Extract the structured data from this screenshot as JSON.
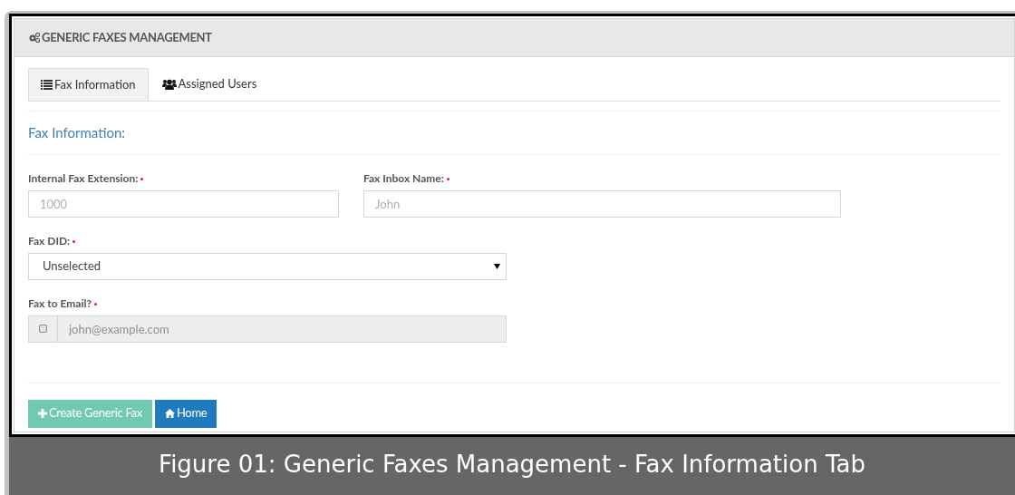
{
  "panel": {
    "title": "GENERIC FAXES MANAGEMENT"
  },
  "tabs": [
    {
      "label": "Fax Information",
      "selected": true
    },
    {
      "label": "Assigned Users",
      "selected": false
    }
  ],
  "section_title": "Fax Information:",
  "fields": [
    {
      "kind": "text",
      "label": "Internal Fax Extension:",
      "required": true,
      "placeholder": "1000"
    },
    {
      "kind": "text",
      "label": "Fax Inbox Name:",
      "required": true,
      "placeholder": "John"
    },
    {
      "kind": "select",
      "label": "Fax DID:",
      "required": true,
      "value": "Unselected"
    },
    {
      "kind": "checkbox-text",
      "label": "Fax to Email?",
      "required": true,
      "checked": false,
      "disabled": true,
      "placeholder": "john@example.com"
    }
  ],
  "buttons": [
    {
      "label": "Create Generic Fax",
      "color": "#70c9b0"
    },
    {
      "label": "Home",
      "color": "#1f7bbd"
    }
  ],
  "caption": "Figure 01: Generic Faxes Management - Fax Information Tab"
}
